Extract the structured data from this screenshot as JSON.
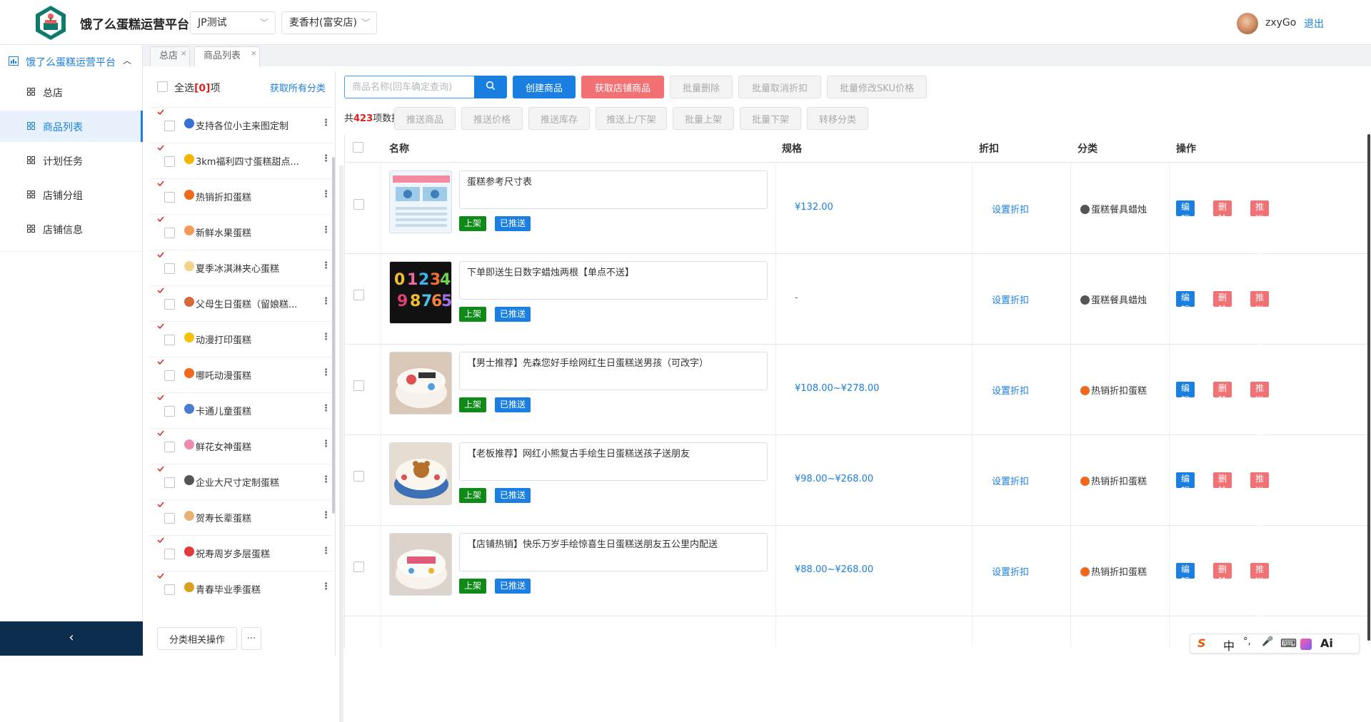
{
  "header": {
    "app_title": "饿了么蛋糕运营平台",
    "account_select": "JP测试",
    "store_select": "麦香村(富安店)",
    "username": "zxyGo",
    "logout": "退出"
  },
  "sidebar": {
    "group_title": "饿了么蛋糕运营平台",
    "items": [
      {
        "label": "总店"
      },
      {
        "label": "商品列表"
      },
      {
        "label": "计划任务"
      },
      {
        "label": "店铺分组"
      },
      {
        "label": "店铺信息"
      }
    ],
    "active_index": 1
  },
  "tabs": [
    {
      "label": "总店"
    },
    {
      "label": "商品列表"
    }
  ],
  "categories": {
    "select_all_prefix": "全选",
    "select_all_count": "[0]",
    "select_all_suffix": "项",
    "fetch_all": "获取所有分类",
    "items": [
      {
        "label": "支持各位小主来图定制",
        "icon": "phone-icon",
        "color": "#3a6fd8"
      },
      {
        "label": "3km福利四寸蛋糕甜点...",
        "icon": "pacman-icon",
        "color": "#f5b400"
      },
      {
        "label": "热销折扣蛋糕",
        "icon": "fire-icon",
        "color": "#f06a1e"
      },
      {
        "label": "新鲜水果蛋糕",
        "icon": "peach-icon",
        "color": "#f59a5a"
      },
      {
        "label": "夏季冰淇淋夹心蛋糕",
        "icon": "icecream-icon",
        "color": "#f3d38a"
      },
      {
        "label": "父母生日蛋糕（留娘糕...",
        "icon": "family-icon",
        "color": "#d46a3c"
      },
      {
        "label": "动漫打印蛋糕",
        "icon": "lightning-icon",
        "color": "#f4c20d"
      },
      {
        "label": "哪吒动漫蛋糕",
        "icon": "fire-icon",
        "color": "#f06a1e"
      },
      {
        "label": "卡通儿童蛋糕",
        "icon": "brush-icon",
        "color": "#4a7bd0"
      },
      {
        "label": "鲜花女神蛋糕",
        "icon": "flower-icon",
        "color": "#f08ab0"
      },
      {
        "label": "企业大尺寸定制蛋糕",
        "icon": "briefcase-icon",
        "color": "#555555"
      },
      {
        "label": "贺寿长辈蛋糕",
        "icon": "elder-icon",
        "color": "#e7b27a"
      },
      {
        "label": "祝寿周岁多层蛋糕",
        "icon": "balloon-icon",
        "color": "#e03c3c"
      },
      {
        "label": "青春毕业季蛋糕",
        "icon": "graduation-icon",
        "color": "#d8a020"
      }
    ],
    "ops_button": "分类相关操作",
    "more_button": "···"
  },
  "toolbar": {
    "search_placeholder": "商品名称(回车确定查询)",
    "create": "创建商品",
    "fetch_store": "获取店铺商品",
    "batch_delete": "批量删除",
    "batch_cancel_discount": "批量取消折扣",
    "batch_edit_sku": "批量修改SKU价格",
    "total_prefix": "共",
    "total_count": "423",
    "total_suffix": "项数据",
    "push_goods": "推送商品",
    "push_price": "推送价格",
    "push_stock": "推送库存",
    "push_shelf": "推送上/下架",
    "batch_on": "批量上架",
    "batch_off": "批量下架",
    "move_category": "转移分类"
  },
  "table": {
    "headers": {
      "name": "名称",
      "spec": "规格",
      "discount": "折扣",
      "category": "分类",
      "actions": "操作"
    },
    "status_on": "上架",
    "status_pushed": "已推送",
    "set_discount": "设置折扣",
    "op_edit": "编辑",
    "op_delete": "删除",
    "op_push_discount": "推送折扣状态",
    "rows": [
      {
        "name": "蛋糕参考尺寸表",
        "price": "¥132.00",
        "category": "蛋糕餐具蜡烛",
        "cat_icon_color": "#555555"
      },
      {
        "name": "下单即送生日数字蜡烛两根【单点不送】",
        "price": "-",
        "category": "蛋糕餐具蜡烛",
        "cat_icon_color": "#555555"
      },
      {
        "name": "【男士推荐】先森您好手绘网红生日蛋糕送男孩（可改字）",
        "price": "¥108.00~¥278.00",
        "category": "热销折扣蛋糕",
        "cat_icon_color": "#f06a1e"
      },
      {
        "name": "【老板推荐】网红小熊复古手绘生日蛋糕送孩子送朋友",
        "price": "¥98.00~¥268.00",
        "category": "热销折扣蛋糕",
        "cat_icon_color": "#f06a1e"
      },
      {
        "name": "【店铺热销】快乐万岁手绘惊喜生日蛋糕送朋友五公里内配送",
        "price": "¥88.00~¥268.00",
        "category": "热销折扣蛋糕",
        "cat_icon_color": "#f06a1e"
      }
    ]
  },
  "ime": {
    "s": "S",
    "zh": "中",
    "dot": "°,",
    "mic": "🎤",
    "kbd": "⌨",
    "ai": "Ai"
  },
  "colors": {
    "primary": "#1a7fe0",
    "danger": "#f27175",
    "success": "#0e8a16",
    "sidebar_footer": "#0d2d4e"
  }
}
